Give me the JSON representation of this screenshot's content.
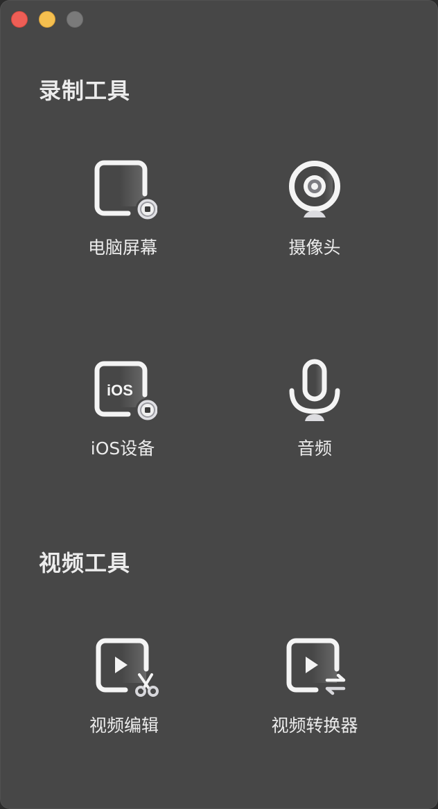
{
  "window": {
    "traffic_lights": [
      "close",
      "minimize",
      "zoom"
    ]
  },
  "sections": {
    "record": {
      "title": "录制工具",
      "items": [
        {
          "label": "电脑屏幕",
          "icon": "screen-record-icon"
        },
        {
          "label": "摄像头",
          "icon": "webcam-icon"
        },
        {
          "label": "iOS设备",
          "icon": "ios-device-record-icon",
          "icon_text": "iOS"
        },
        {
          "label": "音频",
          "icon": "microphone-icon"
        }
      ]
    },
    "video": {
      "title": "视频工具",
      "items": [
        {
          "label": "视频编辑",
          "icon": "video-edit-icon"
        },
        {
          "label": "视频转换器",
          "icon": "video-convert-icon"
        }
      ]
    }
  },
  "colors": {
    "background": "#474747",
    "text": "#ececec",
    "close": "#ee5e56",
    "minimize": "#f5bf4f",
    "zoom": "#7a7a7a"
  }
}
